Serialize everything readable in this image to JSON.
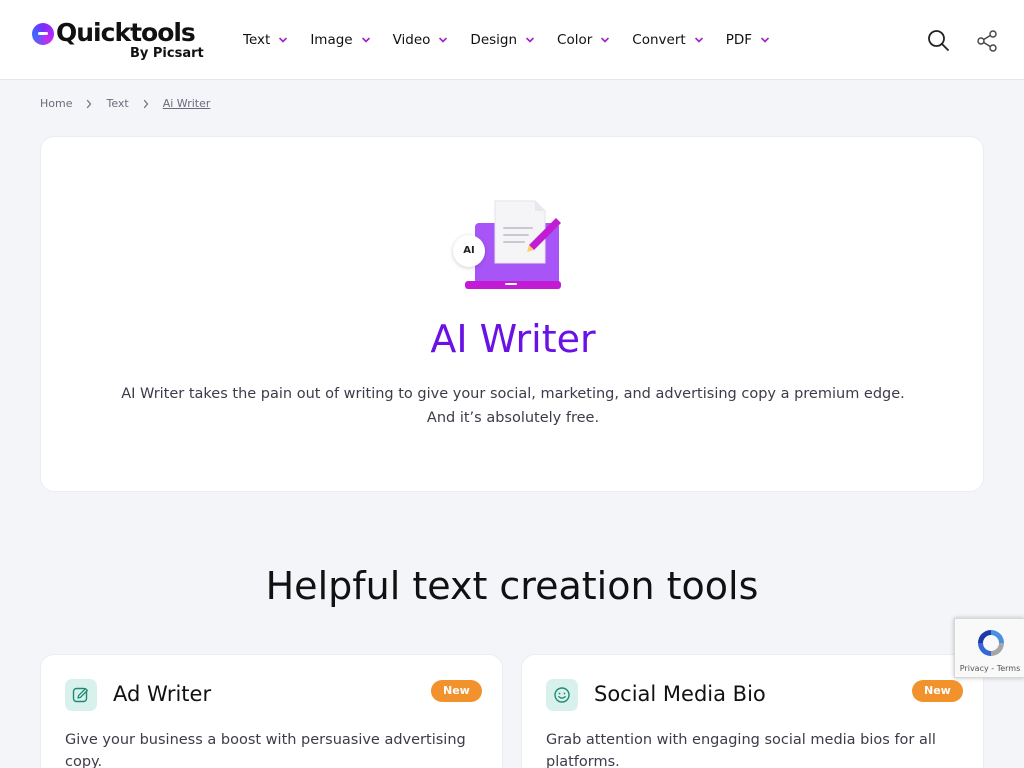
{
  "brand": {
    "name": "Quicktools",
    "sub": "By Picsart"
  },
  "colors": {
    "accent": "#6a12e6",
    "nav_chevron": "#a020c8",
    "badge": "#f2922c",
    "tool_icon_bg": "#d9f1ec"
  },
  "nav": {
    "items": [
      {
        "label": "Text"
      },
      {
        "label": "Image"
      },
      {
        "label": "Video"
      },
      {
        "label": "Design"
      },
      {
        "label": "Color"
      },
      {
        "label": "Convert"
      },
      {
        "label": "PDF"
      }
    ],
    "search_icon": "search-icon",
    "share_icon": "share-icon"
  },
  "breadcrumb": {
    "items": [
      {
        "label": "Home"
      },
      {
        "label": "Text"
      },
      {
        "label": "Ai Writer"
      }
    ]
  },
  "hero": {
    "illustration_badge": "AI",
    "title": "AI Writer",
    "description_line1": "AI Writer takes the pain out of writing to give your social, marketing, and advertising copy a premium edge.",
    "description_line2": "And it’s absolutely free."
  },
  "section": {
    "title": "Helpful text creation tools"
  },
  "tools": [
    {
      "name": "Ad Writer",
      "badge": "New",
      "description": "Give your business a boost with persuasive advertising copy.",
      "icon": "edit-icon"
    },
    {
      "name": "Social Media Bio",
      "badge": "New",
      "description": "Grab attention with engaging social media bios for all platforms.",
      "icon": "smiley-icon"
    }
  ],
  "recaptcha": {
    "text": "Privacy - Terms"
  }
}
